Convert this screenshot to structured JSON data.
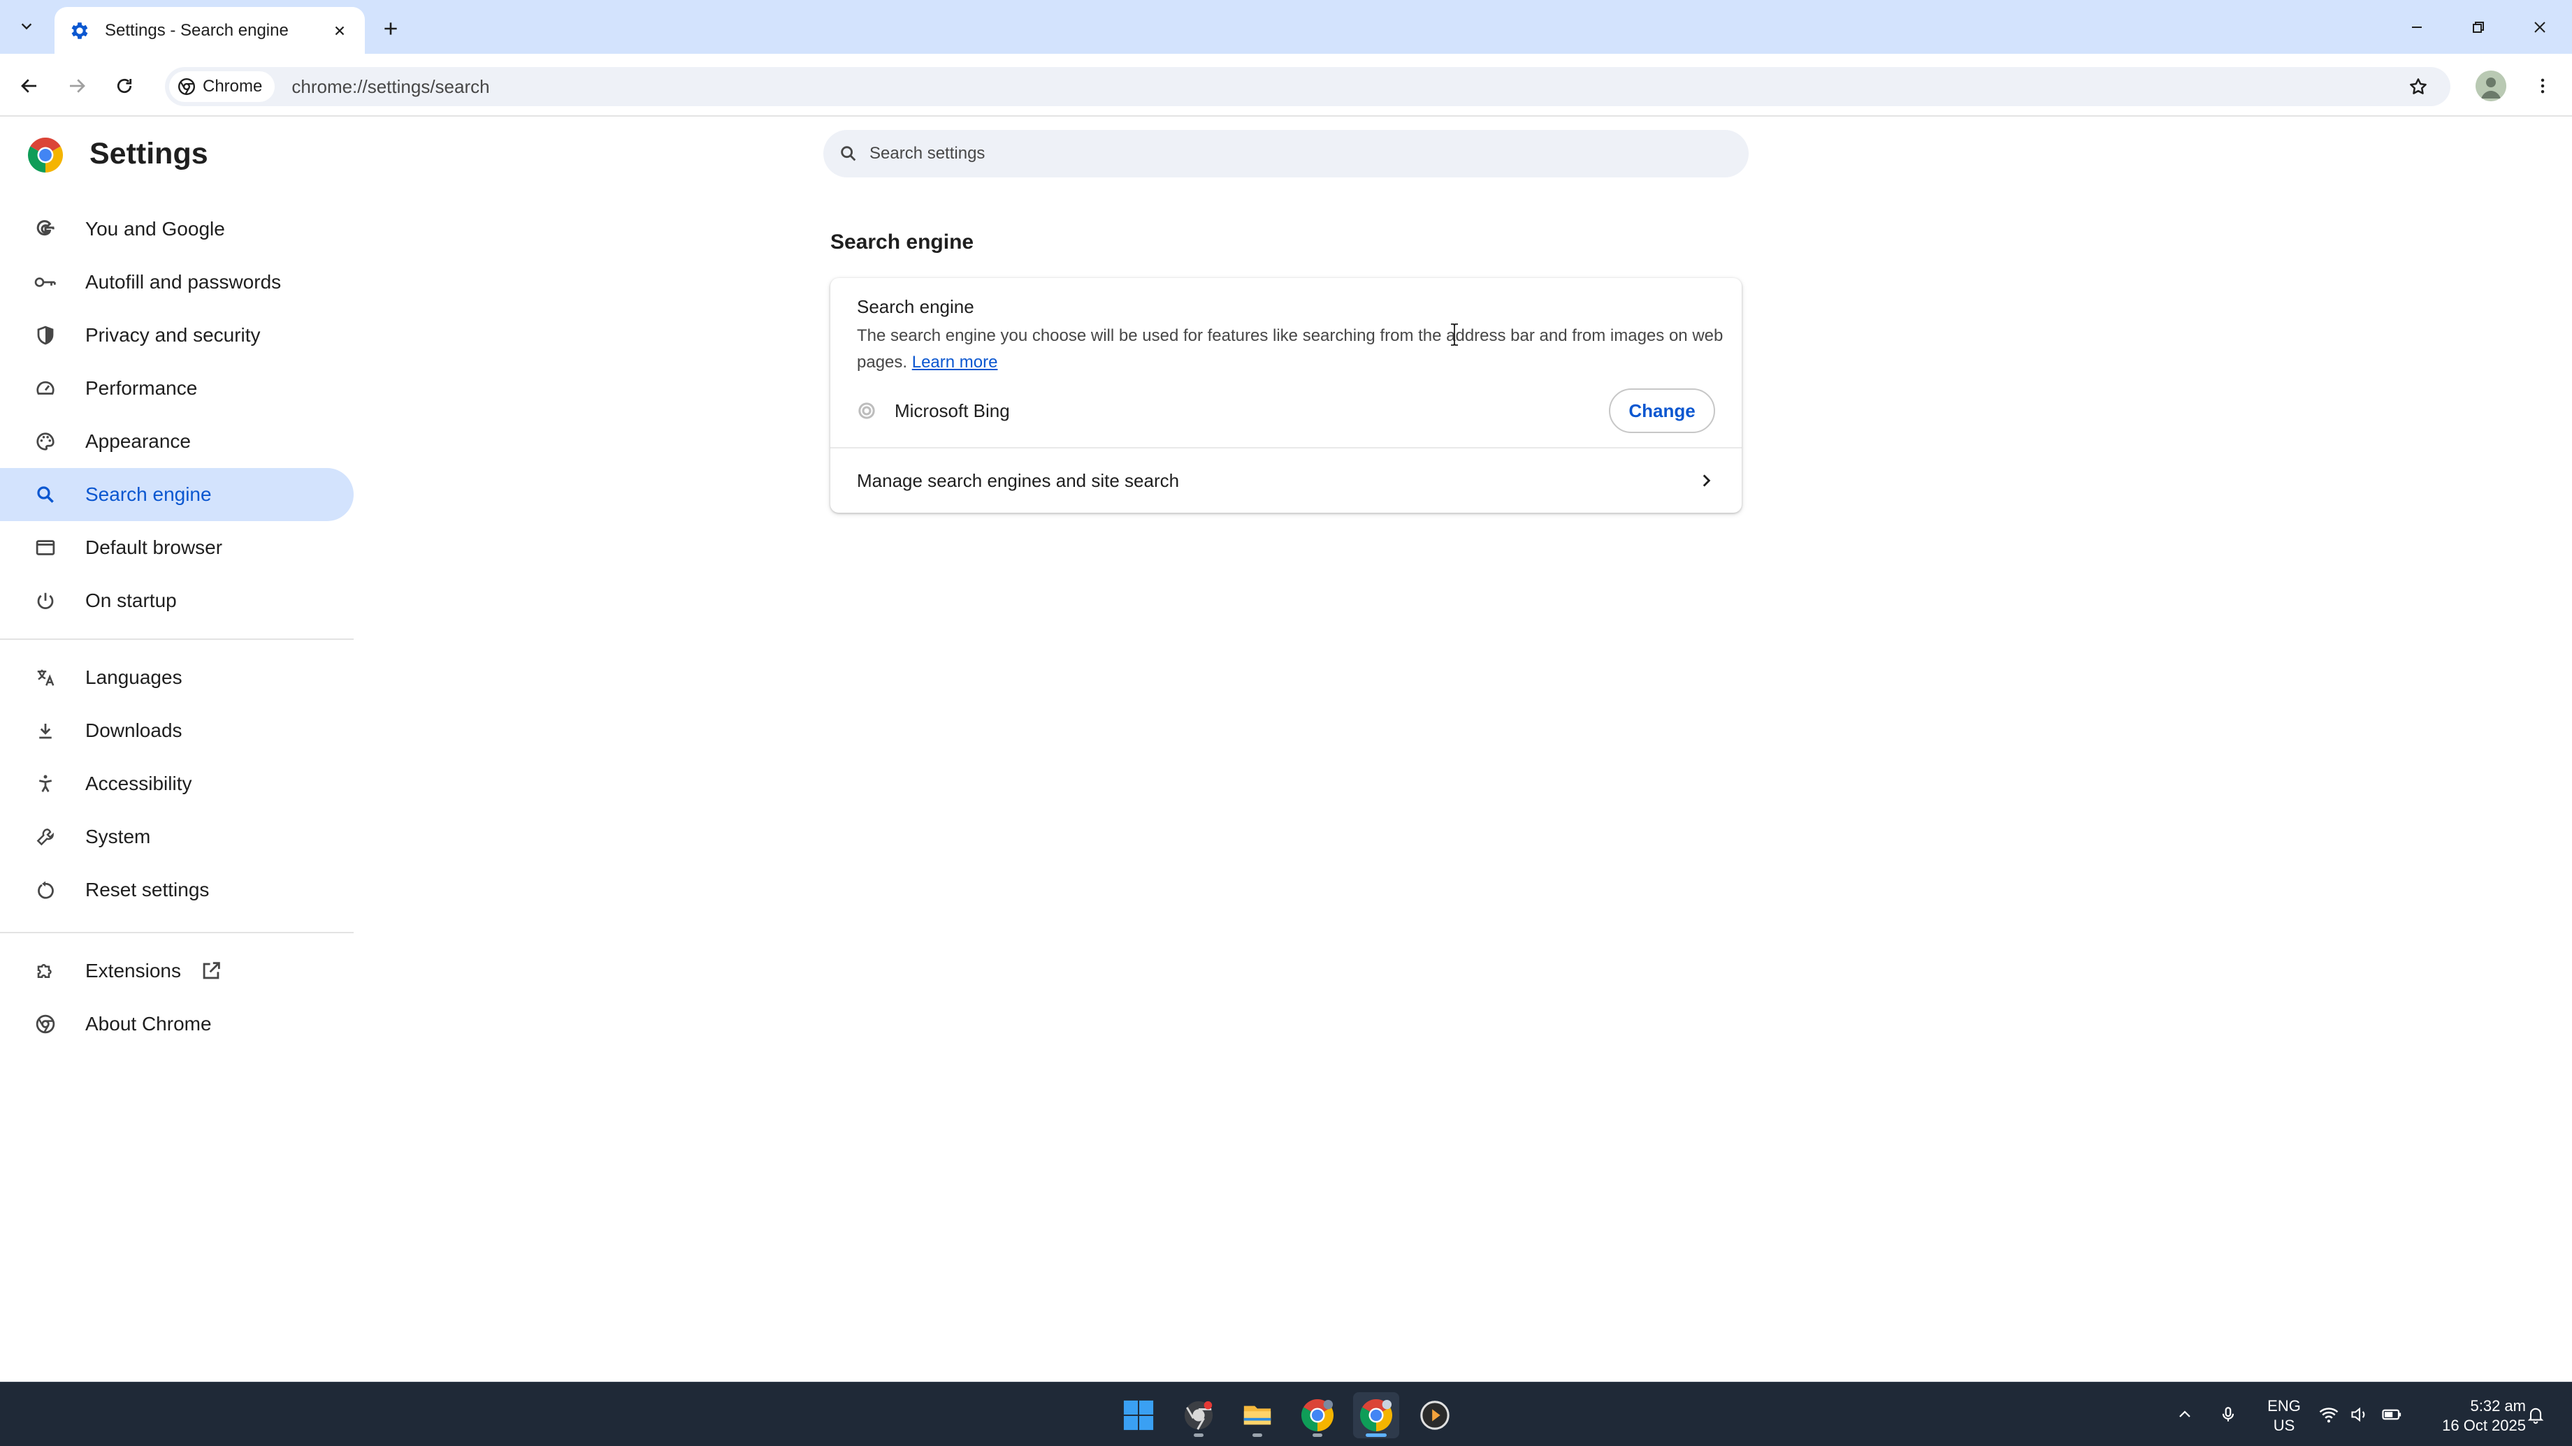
{
  "browser": {
    "tab": {
      "title": "Settings - Search engine"
    },
    "address_bar": {
      "chip_label": "Chrome",
      "url": "chrome://settings/search"
    }
  },
  "settings": {
    "title": "Settings",
    "search_placeholder": "Search settings",
    "sidebar": {
      "items": [
        {
          "label": "You and Google",
          "icon": "google-icon"
        },
        {
          "label": "Autofill and passwords",
          "icon": "key-icon"
        },
        {
          "label": "Privacy and security",
          "icon": "shield-icon"
        },
        {
          "label": "Performance",
          "icon": "speedometer-icon"
        },
        {
          "label": "Appearance",
          "icon": "palette-icon"
        },
        {
          "label": "Search engine",
          "icon": "search-icon",
          "active": true
        },
        {
          "label": "Default browser",
          "icon": "browser-window-icon"
        },
        {
          "label": "On startup",
          "icon": "power-icon"
        },
        {
          "label": "Languages",
          "icon": "translate-icon"
        },
        {
          "label": "Downloads",
          "icon": "download-icon"
        },
        {
          "label": "Accessibility",
          "icon": "accessibility-icon"
        },
        {
          "label": "System",
          "icon": "wrench-icon"
        },
        {
          "label": "Reset settings",
          "icon": "reset-icon"
        },
        {
          "label": "Extensions",
          "icon": "puzzle-icon"
        },
        {
          "label": "About Chrome",
          "icon": "chrome-icon"
        }
      ]
    },
    "main": {
      "section_title": "Search engine",
      "card": {
        "heading": "Search engine",
        "description": "The search engine you choose will be used for features like searching from the address bar and from images on web pages.",
        "learn_more": "Learn more",
        "current_engine": "Microsoft Bing",
        "change_button": "Change",
        "manage_link": "Manage search engines and site search"
      }
    }
  },
  "taskbar": {
    "language": {
      "line1": "ENG",
      "line2": "US"
    },
    "clock": {
      "time": "5:32 am",
      "date": "16 Oct 2025"
    }
  },
  "colors": {
    "accent": "#0b57d0",
    "active_nav_bg": "#d3e3fd",
    "tabstrip_bg": "#d3e3fd",
    "taskbar_bg": "#1f2937"
  }
}
